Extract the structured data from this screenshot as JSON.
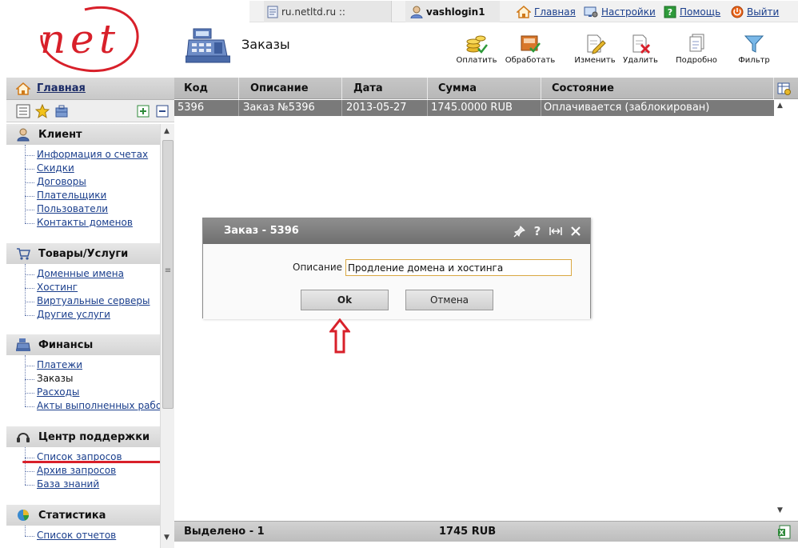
{
  "top": {
    "host": "ru.netltd.ru ::",
    "user": "vashlogin1",
    "links": [
      {
        "label": "Главная",
        "icon": "home-icon"
      },
      {
        "label": "Настройки",
        "icon": "settings-icon"
      },
      {
        "label": "Помощь",
        "icon": "help-icon"
      },
      {
        "label": "Выйти",
        "icon": "power-icon"
      }
    ]
  },
  "page": {
    "title": "Заказы"
  },
  "toolbar": {
    "pay": "Оплатить",
    "process": "Обработать",
    "edit": "Изменить",
    "delete": "Удалить",
    "details": "Подробно",
    "filter": "Фильтр"
  },
  "sidebar": {
    "home": "Главная",
    "groups": [
      {
        "title": "Клиент",
        "icon": "client-icon",
        "items": [
          "Информация о счетах",
          "Скидки",
          "Договоры",
          "Плательщики",
          "Пользователи",
          "Контакты доменов"
        ]
      },
      {
        "title": "Товары/Услуги",
        "icon": "cart-icon",
        "items": [
          "Доменные имена",
          "Хостинг",
          "Виртуальные серверы",
          "Другие услуги"
        ]
      },
      {
        "title": "Финансы",
        "icon": "register-icon",
        "items": [
          "Платежи",
          "Заказы",
          "Расходы",
          "Акты выполненных работ"
        ]
      },
      {
        "title": "Центр поддержки",
        "icon": "headset-icon",
        "items": [
          "Список запросов",
          "Архив запросов",
          "База знаний"
        ]
      },
      {
        "title": "Статистика",
        "icon": "chart-icon",
        "items": [
          "Список отчетов"
        ]
      }
    ],
    "active_item": "Заказы"
  },
  "grid": {
    "columns": [
      "Код",
      "Описание",
      "Дата",
      "Сумма",
      "Состояние"
    ],
    "rows": [
      [
        "5396",
        "Заказ №5396",
        "2013-05-27",
        "1745.0000 RUB",
        "Оплачивается (заблокирован)"
      ]
    ],
    "footer": {
      "selected": "Выделено - 1",
      "total": "1745 RUB"
    }
  },
  "dialog": {
    "title": "Заказ - 5396",
    "label": "Описание",
    "value": "Продление домена и хостинга",
    "ok": "Ok",
    "cancel": "Отмена"
  },
  "colors": {
    "accent_red": "#d8202a",
    "header_gray": "#7a7a7a"
  }
}
